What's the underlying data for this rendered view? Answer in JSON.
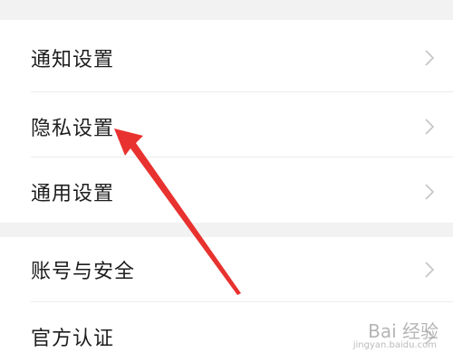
{
  "settings": {
    "group1": [
      {
        "label": "通知设置"
      },
      {
        "label": "隐私设置"
      },
      {
        "label": "通用设置"
      }
    ],
    "group2": [
      {
        "label": "账号与安全"
      },
      {
        "label": "官方认证"
      }
    ]
  },
  "watermark": {
    "logo_text": "Bai 经验",
    "url": "jingyan.baidu.com"
  },
  "colors": {
    "background": "#f2f2f2",
    "row_background": "#ffffff",
    "text": "#1e1e1e",
    "chevron": "#c4c4c4",
    "annotation_arrow": "#e8322f"
  },
  "icons": {
    "row_chevron": "chevron-right-icon",
    "annotation": "red-arrow-annotation"
  }
}
